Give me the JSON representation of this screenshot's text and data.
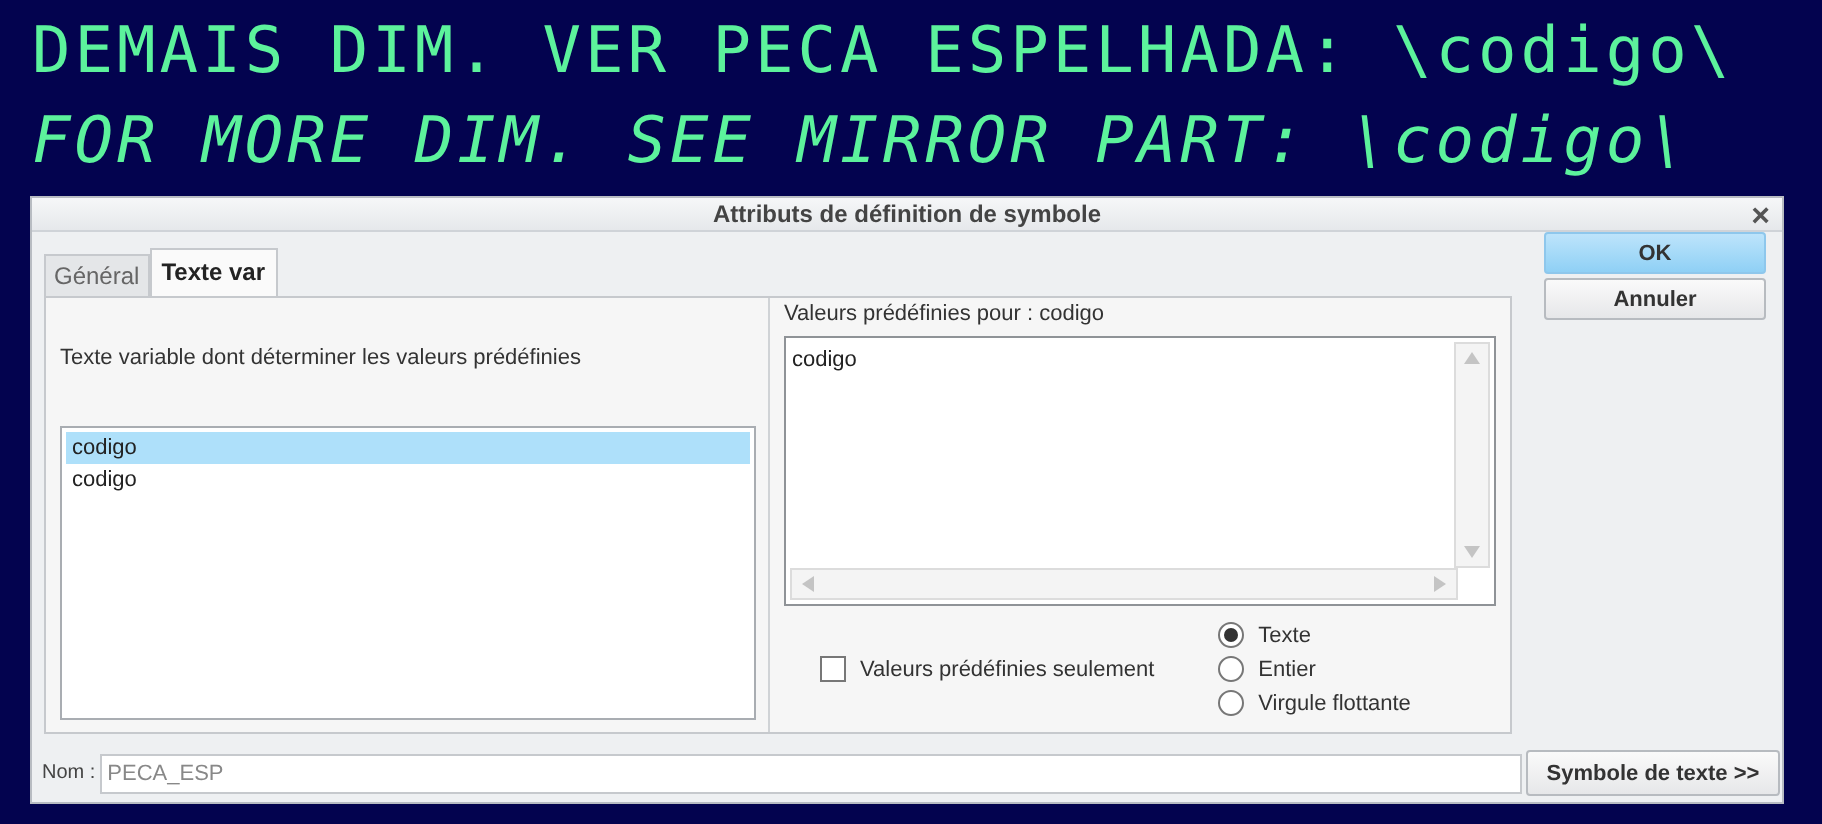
{
  "drawing_text": [
    {
      "text": "DEMAIS DIM. VER PECA ESPELHADA: \\codigo\\",
      "italic": false
    },
    {
      "text": "FOR MORE DIM. SEE MIRROR PART: \\codigo\\",
      "italic": true
    }
  ],
  "dialog": {
    "title": "Attributs de définition de symbole",
    "close": "×",
    "tabs": [
      {
        "label": "Général",
        "selected": false
      },
      {
        "label": "Texte var",
        "selected": true
      }
    ],
    "left": {
      "label": "Texte variable dont déterminer les valeurs prédéfinies",
      "variables": [
        {
          "label": "codigo",
          "selected": true
        },
        {
          "label": "codigo",
          "selected": false
        }
      ]
    },
    "right": {
      "label": "Valeurs prédéfinies pour :  codigo",
      "values": [
        "codigo"
      ],
      "checkbox": {
        "label": "Valeurs prédéfinies seulement",
        "checked": false
      },
      "types": [
        {
          "label": "Texte",
          "selected": true
        },
        {
          "label": "Entier",
          "selected": false
        },
        {
          "label": "Virgule flottante",
          "selected": false
        }
      ]
    },
    "buttons": [
      {
        "label": "OK",
        "primary": true
      },
      {
        "label": "Annuler",
        "primary": false
      }
    ],
    "name": {
      "label": "Nom :",
      "value": "PECA_ESP"
    },
    "symbol_button": "Symbole de texte >>"
  }
}
